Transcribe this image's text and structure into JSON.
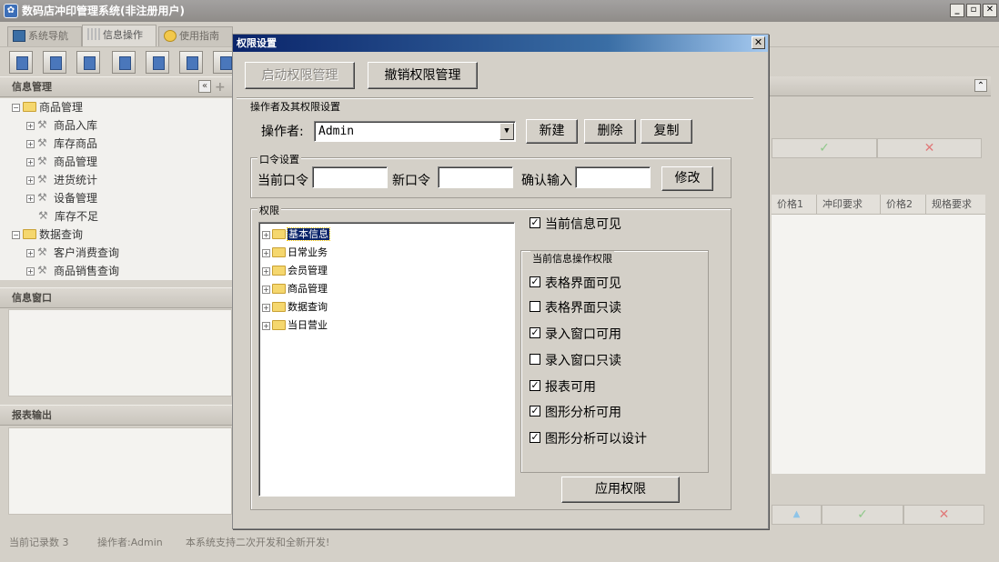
{
  "app": {
    "title": "数码店冲印管理系统(非注册用户)",
    "window_controls": {
      "minimize": "_",
      "restore": "▫",
      "close": "✕"
    },
    "tabs": [
      {
        "label": "系统导航"
      },
      {
        "label": "信息操作"
      },
      {
        "label": "使用指南"
      }
    ]
  },
  "left_panel": {
    "info_manage": {
      "title": "信息管理",
      "collapse_glyph": "«",
      "add_glyph": "+",
      "items": [
        {
          "label": "商品管理"
        },
        {
          "label": "商品入库"
        },
        {
          "label": "库存商品"
        },
        {
          "label": "商品管理"
        },
        {
          "label": "进货统计"
        },
        {
          "label": "设备管理"
        },
        {
          "label": "库存不足"
        },
        {
          "label": "数据查询"
        },
        {
          "label": "客户消费查询"
        },
        {
          "label": "商品销售查询"
        }
      ]
    },
    "info_window": {
      "title": "信息窗口"
    },
    "report_output": {
      "title": "报表输出"
    }
  },
  "background_grid": {
    "columns": [
      "价格1",
      "冲印要求",
      "价格2",
      "规格要求"
    ],
    "check_glyph": "✓",
    "cross_glyph": "✕",
    "up_glyph": "▲",
    "collapse_glyph": "⌃"
  },
  "status_bar": {
    "record_count": "当前记录数 3",
    "operator": "操作者:Admin",
    "message": "本系统支持二次开发和全新开发!"
  },
  "dialog": {
    "title": "权限设置",
    "close_glyph": "✕",
    "enable_button": "启动权限管理",
    "revoke_button": "撤销权限管理",
    "operator_section": {
      "title": "操作者及其权限设置",
      "operator_label": "操作者:",
      "operator_value": "Admin",
      "new_button": "新建",
      "delete_button": "删除",
      "copy_button": "复制"
    },
    "password_section": {
      "title": "口令设置",
      "current_label": "当前口令",
      "new_label": "新口令",
      "confirm_label": "确认输入",
      "modify_button": "修改"
    },
    "permission_section": {
      "title": "权限",
      "tree": [
        {
          "label": "基本信息",
          "selected": true
        },
        {
          "label": "日常业务"
        },
        {
          "label": "会员管理"
        },
        {
          "label": "商品管理"
        },
        {
          "label": "数据查询"
        },
        {
          "label": "当日营业"
        }
      ],
      "visible_check": {
        "label": "当前信息可见",
        "checked": true
      },
      "ops_title": "当前信息操作权限",
      "ops": [
        {
          "label": "表格界面可见",
          "checked": true
        },
        {
          "label": "表格界面只读",
          "checked": false
        },
        {
          "label": "录入窗口可用",
          "checked": true
        },
        {
          "label": "录入窗口只读",
          "checked": false
        },
        {
          "label": "报表可用",
          "checked": true
        },
        {
          "label": "图形分析可用",
          "checked": true
        },
        {
          "label": "图形分析可以设计",
          "checked": true
        }
      ],
      "apply_button": "应用权限"
    }
  }
}
